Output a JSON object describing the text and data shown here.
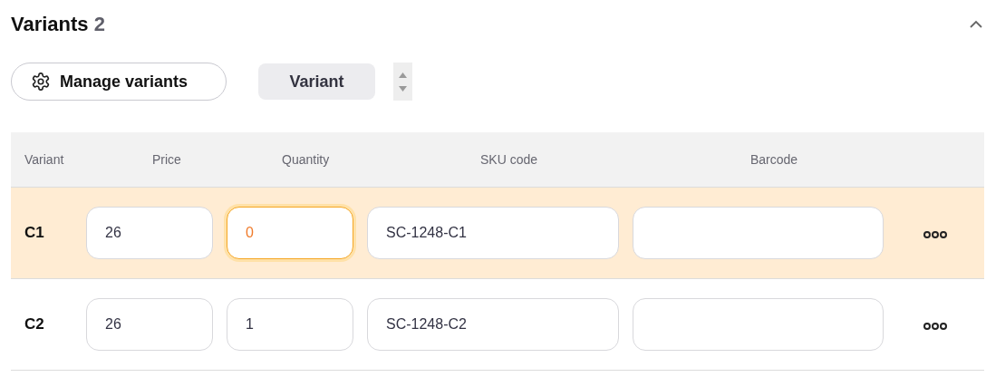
{
  "section": {
    "title": "Variants",
    "count": "2",
    "expanded": true
  },
  "toolbar": {
    "manage_button": "Manage variants",
    "variant_chip": "Variant"
  },
  "table": {
    "columns": [
      "Variant",
      "Price",
      "Quantity",
      "SKU code",
      "Barcode"
    ],
    "rows": [
      {
        "variant": "C1",
        "price": "26",
        "quantity": "0",
        "sku": "SC-1248-C1",
        "selected": true,
        "quantity_focused": true
      },
      {
        "variant": "C2",
        "price": "26",
        "quantity": "1",
        "sku": "SC-1248-C2",
        "selected": false,
        "quantity_focused": false
      }
    ]
  }
}
